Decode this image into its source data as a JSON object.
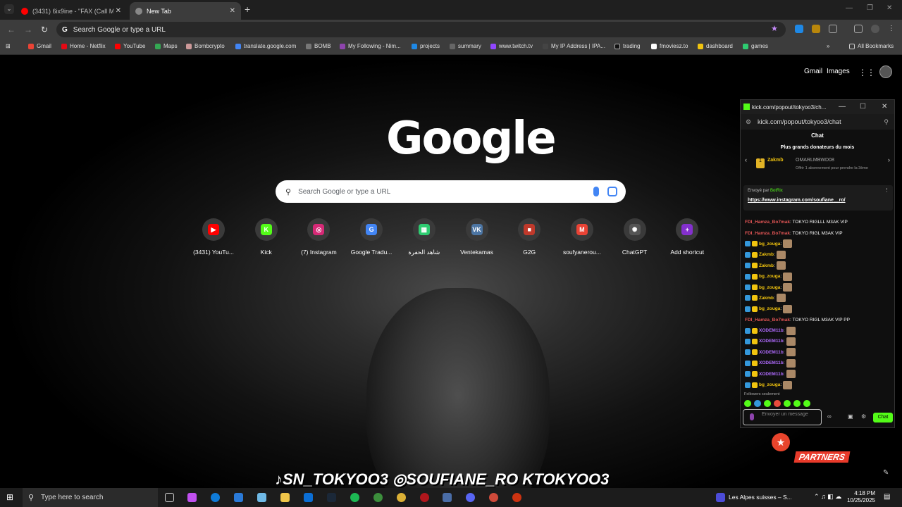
{
  "tabs": [
    {
      "label": "(3431) 6ix9ine - \"FAX (Call Me W",
      "active": false
    },
    {
      "label": "New Tab",
      "active": true
    }
  ],
  "omnibox": {
    "placeholder": "Search Google or type a URL"
  },
  "bookmarks": [
    "Gmail",
    "Home - Netflix",
    "YouTube",
    "Maps",
    "Bombcrypto",
    "translate.google.com",
    "BOMB",
    "My Following - Nim...",
    "projects",
    "summary",
    "www.twitch.tv",
    "My IP Address | IPA...",
    "trading",
    "fmoviesz.to",
    "dashboard",
    "games"
  ],
  "all_bookmarks": "All Bookmarks",
  "google": {
    "gmail": "Gmail",
    "images": "Images",
    "logo": "Google",
    "search_placeholder": "Search Google or type a URL"
  },
  "shortcuts": [
    {
      "label": "(3431) YouTu...",
      "color": "#ff0000",
      "glyph": "▶"
    },
    {
      "label": "Kick",
      "color": "#53fc18",
      "glyph": "K"
    },
    {
      "label": "(7) Instagram",
      "color": "#d62976",
      "glyph": "◎"
    },
    {
      "label": "Google Tradu...",
      "color": "#4285f4",
      "glyph": "G"
    },
    {
      "label": "شاهد الحفرة",
      "color": "#2ecc71",
      "glyph": "▦"
    },
    {
      "label": "Ventekamas",
      "color": "#4c75a3",
      "glyph": "VK"
    },
    {
      "label": "G2G",
      "color": "#c0392b",
      "glyph": "■"
    },
    {
      "label": "soufyanerou...",
      "color": "#ea4335",
      "glyph": "M"
    },
    {
      "label": "ChatGPT",
      "color": "#555555",
      "glyph": "✺"
    },
    {
      "label": "Add shortcut",
      "color": "#8430ce",
      "glyph": "+"
    }
  ],
  "kick": {
    "window_title": "kick.com/popout/tokyoo3/ch...",
    "url": "kick.com/popout/tokyoo3/chat",
    "header": "Chat",
    "top_donors": "Plus grands donateurs du mois",
    "donor1": "Zakmb",
    "donor2": "OMARLMBWD08",
    "donor2_sub": "Offrir 1 abonnement pour prendre la 3ème",
    "pinned_by": "Envoyé par",
    "pinned_bot": "BotRix",
    "pinned_link": "https://www.instagram.com/soufiane__ro/",
    "messages": [
      {
        "user": "FDI_Hamza_Bo7mak",
        "text": ": TOKYO RIGLLL M3AK VIP",
        "color": "#e25555"
      },
      {
        "user": "FDI_Hamza_Bo7mak",
        "text": ": TOKYO RIGL M3AK VIP",
        "color": "#e25555"
      },
      {
        "user": "bg_zouga",
        "text": ":",
        "color": "#f1c40f"
      },
      {
        "user": "Zakmb",
        "text": ":",
        "color": "#f1c40f"
      },
      {
        "user": "Zakmb",
        "text": ":",
        "color": "#f1c40f"
      },
      {
        "user": "bg_zouga",
        "text": ":",
        "color": "#f1c40f"
      },
      {
        "user": "bg_zouga",
        "text": ":",
        "color": "#f1c40f"
      },
      {
        "user": "Zakmb",
        "text": ":",
        "color": "#f1c40f"
      },
      {
        "user": "bg_zouga",
        "text": ":",
        "color": "#f1c40f"
      },
      {
        "user": "FDI_Hamza_Bo7mak",
        "text": ": TOKYO RIGL M3AK VIP PP",
        "color": "#e25555"
      },
      {
        "user": "XODEM11b",
        "text": ":",
        "color": "#b06bff"
      },
      {
        "user": "XODEM11b",
        "text": ":",
        "color": "#b06bff"
      },
      {
        "user": "XODEM11b",
        "text": ":",
        "color": "#b06bff"
      },
      {
        "user": "XODEM11b",
        "text": ":",
        "color": "#b06bff"
      },
      {
        "user": "XODEM11b",
        "text": ":",
        "color": "#b06bff"
      },
      {
        "user": "bg_zouga",
        "text": ":",
        "color": "#f1c40f"
      }
    ],
    "followers_only": "Followers seulement",
    "input_placeholder": "Envoyer un message",
    "chat_button": "Chat"
  },
  "overlay": {
    "handles": "♪SN_TOKYOO3  ◎SOUFIANE_RO  KTOKYOO3",
    "partners": "PARTNERS"
  },
  "taskbar": {
    "search": "Type here to search",
    "media": "Les Alpes suisses – S...",
    "time": "4:18 PM",
    "date": "10/25/2025"
  }
}
